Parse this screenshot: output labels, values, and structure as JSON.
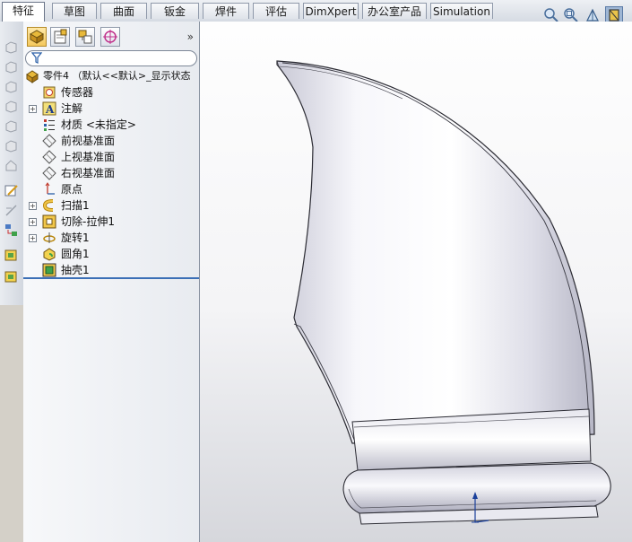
{
  "command_tabs": [
    {
      "label": "特征",
      "active": true
    },
    {
      "label": "草图"
    },
    {
      "label": "曲面"
    },
    {
      "label": "钣金"
    },
    {
      "label": "焊件"
    },
    {
      "label": "评估"
    },
    {
      "label": "DimXpert"
    },
    {
      "label": "办公室产品"
    },
    {
      "label": "Simulation"
    }
  ],
  "view_tools": [
    "zoom-to-fit-icon",
    "zoom-to-area-icon",
    "view-orientation-icon",
    "display-style-icon"
  ],
  "feature_tree": {
    "root": {
      "label": "零件4 （默认<<默认>_显示状态",
      "icon": "part-icon"
    },
    "items": [
      {
        "label": "传感器",
        "icon": "sensor-icon",
        "expandable": false
      },
      {
        "label": "注解",
        "icon": "annotation-icon",
        "expandable": true
      },
      {
        "label": "材质 <未指定>",
        "icon": "material-icon",
        "expandable": false
      },
      {
        "label": "前视基准面",
        "icon": "plane-icon",
        "expandable": false
      },
      {
        "label": "上视基准面",
        "icon": "plane-icon",
        "expandable": false
      },
      {
        "label": "右视基准面",
        "icon": "plane-icon",
        "expandable": false
      },
      {
        "label": "原点",
        "icon": "origin-icon",
        "expandable": false
      },
      {
        "label": "扫描1",
        "icon": "sweep-icon",
        "expandable": true
      },
      {
        "label": "切除-拉伸1",
        "icon": "cut-extrude-icon",
        "expandable": true
      },
      {
        "label": "旋转1",
        "icon": "revolve-icon",
        "expandable": true
      },
      {
        "label": "圆角1",
        "icon": "fillet-icon",
        "expandable": false
      },
      {
        "label": "抽壳1",
        "icon": "shell-icon",
        "expandable": false
      }
    ]
  },
  "panel_tabs": [
    "feature-manager-tab",
    "property-manager-tab",
    "configuration-manager-tab",
    "dimxpert-manager-tab"
  ],
  "colors": {
    "accent": "#3b6fb6",
    "tab_border": "#8f99aa",
    "rollback_bar": "#3b6fb6"
  }
}
